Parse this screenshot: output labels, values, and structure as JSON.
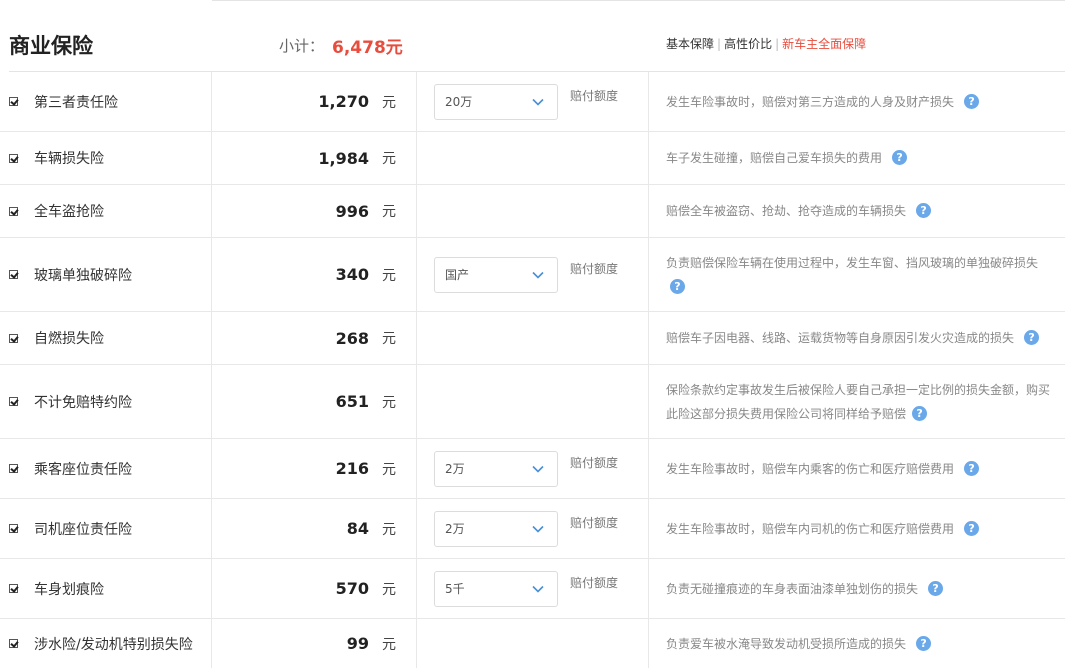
{
  "header": {
    "title": "商业保险",
    "subtotal_label": "小计：",
    "subtotal_value": "6,478元",
    "plans": [
      {
        "label": "基本保障",
        "active": false
      },
      {
        "label": "高性价比",
        "active": false
      },
      {
        "label": "新车主全面保障",
        "active": true
      }
    ]
  },
  "colors": {
    "accent_red": "#e84c3d",
    "help_icon_blue": "#6aa8ea"
  },
  "icons": {
    "checkbox": "checkmark-icon",
    "select": "chevron-down-icon",
    "help": "question-mark-circle-icon"
  },
  "unit_label": "元",
  "option_label": "赔付额度",
  "help_glyph": "?",
  "rows": [
    {
      "name": "第三者责任险",
      "checked": true,
      "price": "1,270",
      "option": "20万",
      "description": "发生车险事故时，赔偿对第三方造成的人身及财产损失"
    },
    {
      "name": "车辆损失险",
      "checked": true,
      "price": "1,984",
      "option": null,
      "description": "车子发生碰撞，赔偿自己爱车损失的费用"
    },
    {
      "name": "全车盗抢险",
      "checked": true,
      "price": "996",
      "option": null,
      "description": "赔偿全车被盗窃、抢劫、抢夺造成的车辆损失"
    },
    {
      "name": "玻璃单独破碎险",
      "checked": true,
      "price": "340",
      "option": "国产",
      "description": "负责赔偿保险车辆在使用过程中，发生车窗、挡风玻璃的单独破碎损失"
    },
    {
      "name": "自燃损失险",
      "checked": true,
      "price": "268",
      "option": null,
      "description": "赔偿车子因电器、线路、运载货物等自身原因引发火灾造成的损失"
    },
    {
      "name": "不计免赔特约险",
      "checked": true,
      "price": "651",
      "option": null,
      "description": "保险条款约定事故发生后被保险人要自己承担一定比例的损失金额，购买此险这部分损失费用保险公司将同样给予赔偿"
    },
    {
      "name": "乘客座位责任险",
      "checked": true,
      "price": "216",
      "option": "2万",
      "description": "发生车险事故时，赔偿车内乘客的伤亡和医疗赔偿费用"
    },
    {
      "name": "司机座位责任险",
      "checked": true,
      "price": "84",
      "option": "2万",
      "description": "发生车险事故时，赔偿车内司机的伤亡和医疗赔偿费用"
    },
    {
      "name": "车身划痕险",
      "checked": true,
      "price": "570",
      "option": "5千",
      "description": "负责无碰撞痕迹的车身表面油漆单独划伤的损失"
    },
    {
      "name": "涉水险/发动机特别损失险",
      "checked": true,
      "price": "99",
      "option": null,
      "description": "负责爱车被水淹导致发动机受损所造成的损失"
    }
  ]
}
